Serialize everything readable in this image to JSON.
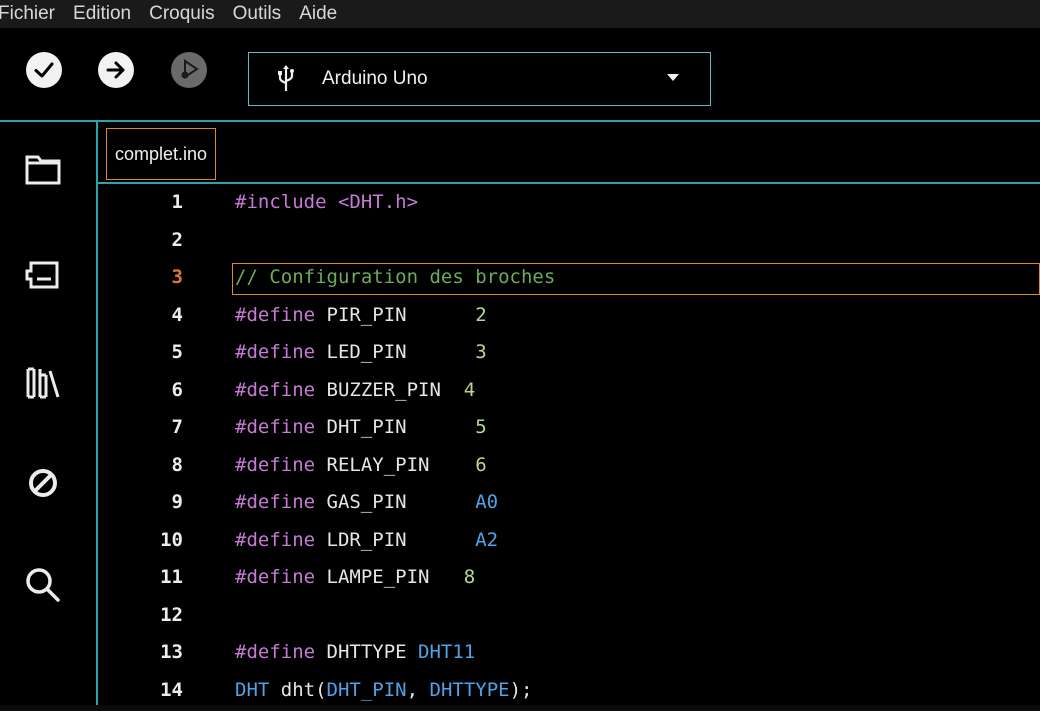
{
  "menu": [
    "Fichier",
    "Edition",
    "Croquis",
    "Outils",
    "Aide"
  ],
  "toolbar": {
    "verify_icon": "checkmark-icon",
    "upload_icon": "arrow-right-icon",
    "debug_icon": "debug-icon",
    "board": "Arduino Uno"
  },
  "sidebar": [
    "folder-icon",
    "board-manager-icon",
    "library-icon",
    "debug-disabled-icon",
    "search-icon"
  ],
  "tab": {
    "name": "complet.ino"
  },
  "editor": {
    "active_line": 3,
    "lines": [
      {
        "n": "1",
        "parts": [
          {
            "c": "kw",
            "t": "#include "
          },
          {
            "c": "kw",
            "t": "<DHT.h>"
          }
        ]
      },
      {
        "n": "2",
        "parts": []
      },
      {
        "n": "3",
        "parts": [
          {
            "c": "cm",
            "t": "// Configuration des broches"
          }
        ]
      },
      {
        "n": "4",
        "parts": [
          {
            "c": "kw",
            "t": "#define "
          },
          {
            "c": "plain",
            "t": "PIR_PIN      "
          },
          {
            "c": "num",
            "t": "2"
          }
        ]
      },
      {
        "n": "5",
        "parts": [
          {
            "c": "kw",
            "t": "#define "
          },
          {
            "c": "plain",
            "t": "LED_PIN      "
          },
          {
            "c": "num",
            "t": "3"
          }
        ]
      },
      {
        "n": "6",
        "parts": [
          {
            "c": "kw",
            "t": "#define "
          },
          {
            "c": "plain",
            "t": "BUZZER_PIN  "
          },
          {
            "c": "num",
            "t": "4"
          }
        ]
      },
      {
        "n": "7",
        "parts": [
          {
            "c": "kw",
            "t": "#define "
          },
          {
            "c": "plain",
            "t": "DHT_PIN      "
          },
          {
            "c": "num",
            "t": "5"
          }
        ]
      },
      {
        "n": "8",
        "parts": [
          {
            "c": "kw",
            "t": "#define "
          },
          {
            "c": "plain",
            "t": "RELAY_PIN    "
          },
          {
            "c": "num",
            "t": "6"
          }
        ]
      },
      {
        "n": "9",
        "parts": [
          {
            "c": "kw",
            "t": "#define "
          },
          {
            "c": "plain",
            "t": "GAS_PIN      "
          },
          {
            "c": "type",
            "t": "A0"
          }
        ]
      },
      {
        "n": "10",
        "parts": [
          {
            "c": "kw",
            "t": "#define "
          },
          {
            "c": "plain",
            "t": "LDR_PIN      "
          },
          {
            "c": "type",
            "t": "A2"
          }
        ]
      },
      {
        "n": "11",
        "parts": [
          {
            "c": "kw",
            "t": "#define "
          },
          {
            "c": "plain",
            "t": "LAMPE_PIN   "
          },
          {
            "c": "num",
            "t": "8"
          }
        ]
      },
      {
        "n": "12",
        "parts": []
      },
      {
        "n": "13",
        "parts": [
          {
            "c": "kw",
            "t": "#define "
          },
          {
            "c": "plain",
            "t": "DHTTYPE "
          },
          {
            "c": "type",
            "t": "DHT11"
          }
        ]
      },
      {
        "n": "14",
        "parts": [
          {
            "c": "type",
            "t": "DHT "
          },
          {
            "c": "plain",
            "t": "dht("
          },
          {
            "c": "type",
            "t": "DHT_PIN"
          },
          {
            "c": "plain",
            "t": ", "
          },
          {
            "c": "type",
            "t": "DHTTYPE"
          },
          {
            "c": "plain",
            "t": ");"
          }
        ]
      }
    ]
  },
  "colors": {
    "accent": "#2aa3ad",
    "highlight": "#d98a2b"
  }
}
